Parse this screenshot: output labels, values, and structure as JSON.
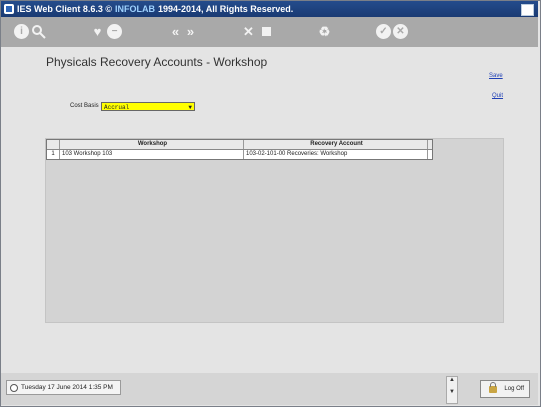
{
  "window": {
    "title_app": "IES Web Client 8.6.3 ©",
    "title_vendor": "INFOLAB",
    "title_rest": "1994-2014, All Rights Reserved."
  },
  "toolbar": {
    "icons": [
      "info-icon",
      "search-icon",
      "favourite-icon",
      "minus-circle-icon",
      "back-icon",
      "forward-icon",
      "tools-icon",
      "stop-icon",
      "recycle-icon",
      "confirm-icon",
      "cancel-icon"
    ]
  },
  "page": {
    "title": "Physicals Recovery Accounts - Workshop",
    "save_label": "Save",
    "quit_label": "Quit"
  },
  "form": {
    "cost_basis_label": "Cost Basis",
    "cost_basis_value": "Accrual"
  },
  "grid": {
    "columns": [
      "Workshop",
      "Recovery Account"
    ],
    "rows": [
      {
        "num": "1",
        "workshop": "103 Workshop 103",
        "recovery_account": "103-02-101-00 Recoveries: Workshop"
      }
    ]
  },
  "status": {
    "datetime": "Tuesday 17 June 2014 1:35 PM",
    "logoff_label": "Log Off"
  },
  "colors": {
    "titlebar": "#1a3a73",
    "toolbar": "#a9a9a9",
    "select_bg": "#ffff00"
  }
}
